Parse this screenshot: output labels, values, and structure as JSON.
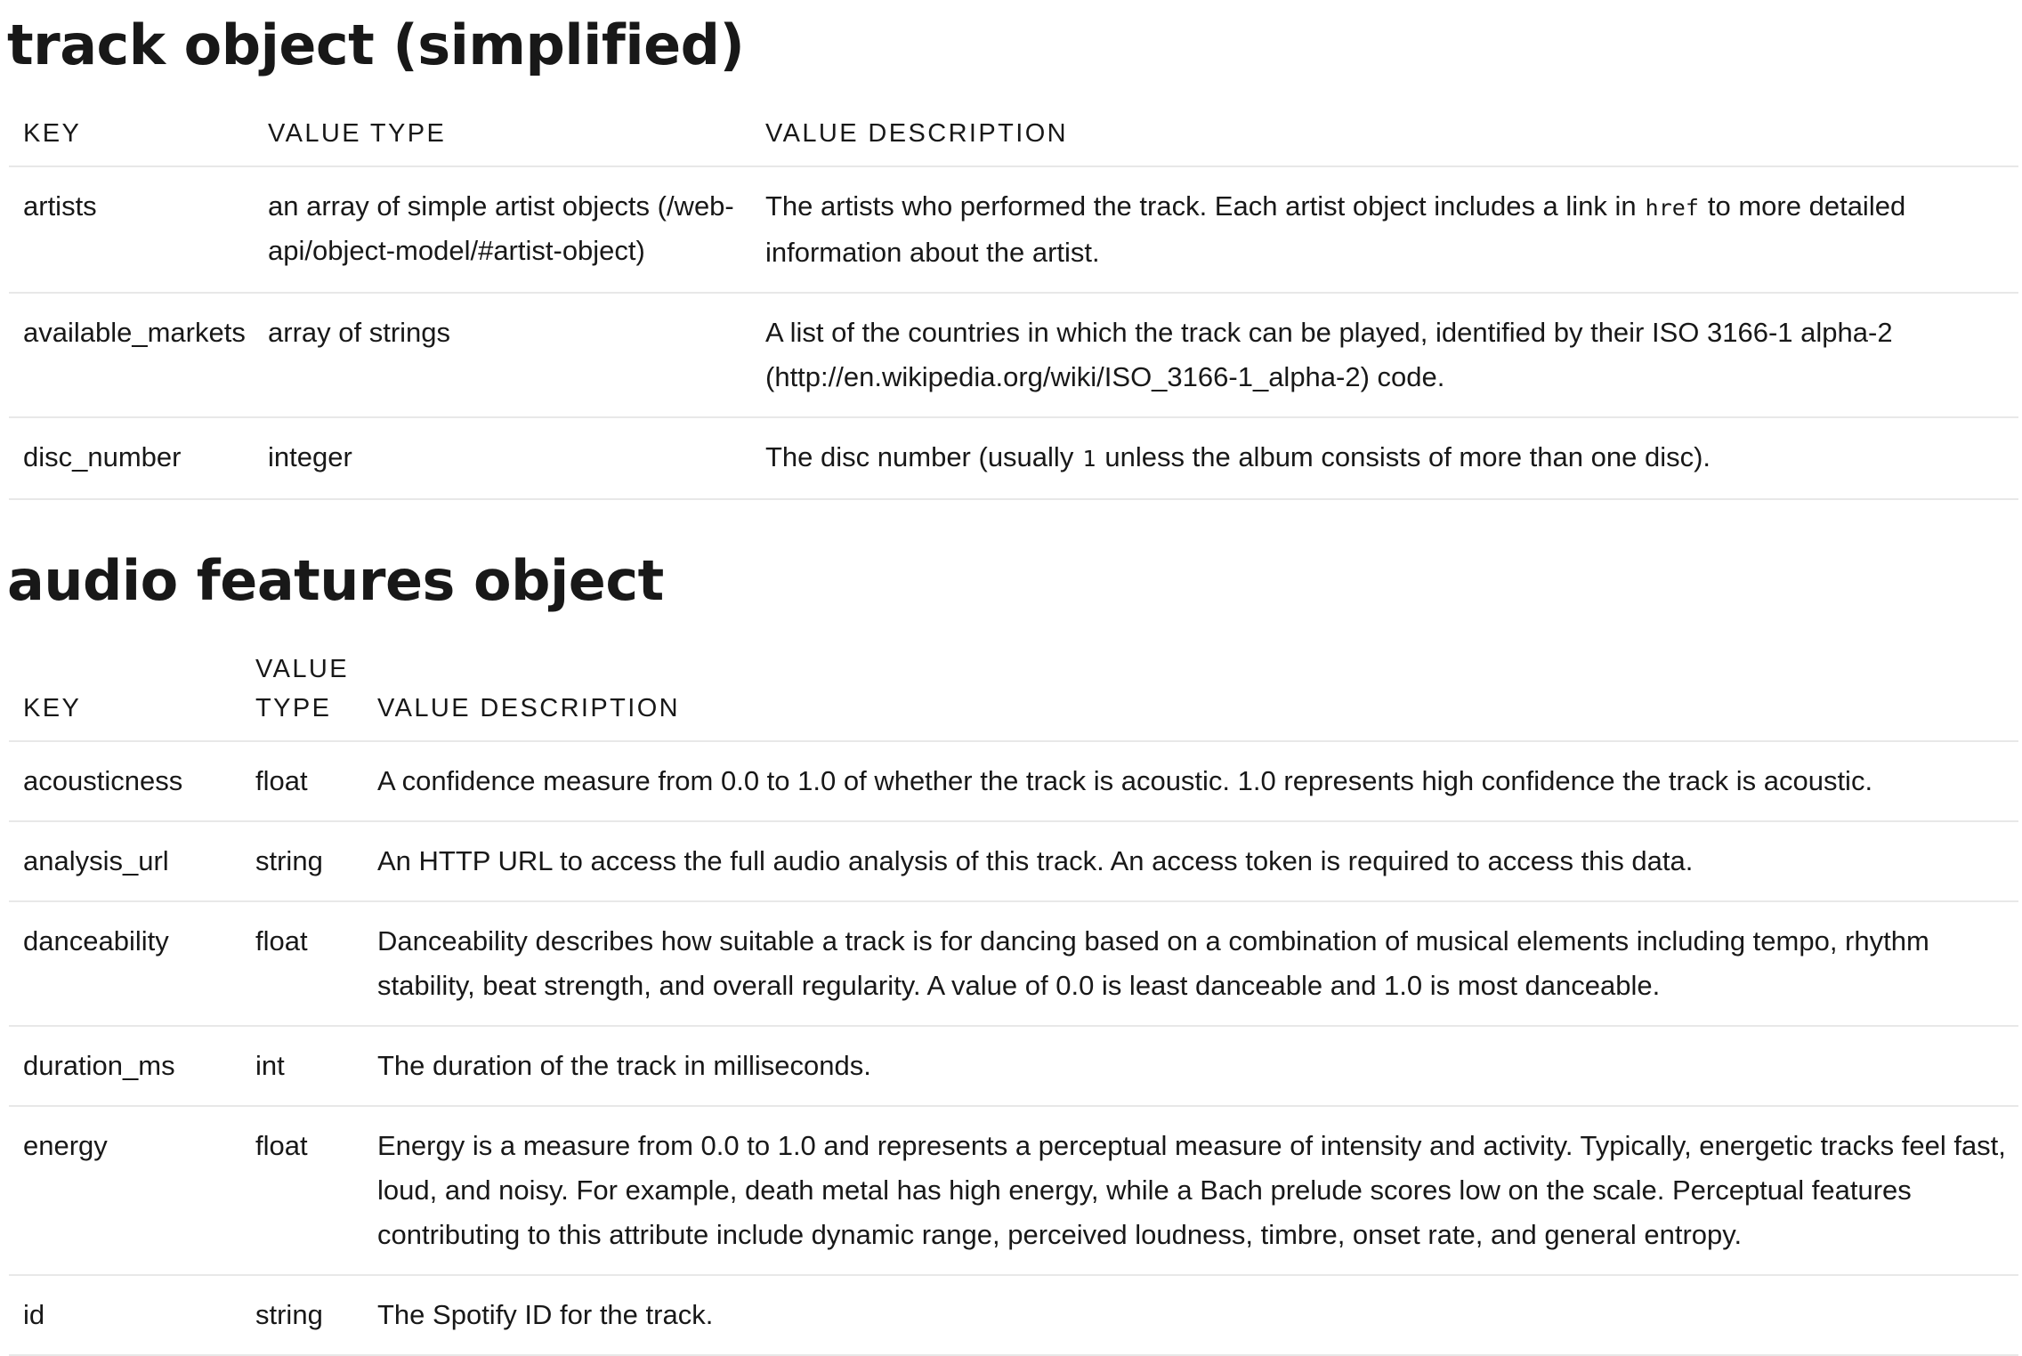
{
  "track_section": {
    "title": "track object (simplified)",
    "headers": {
      "key": "KEY",
      "value_type": "VALUE TYPE",
      "value_description": "VALUE DESCRIPTION"
    },
    "rows": [
      {
        "key": "artists",
        "type": "an array of simple artist objects (/web-api/object-model/#artist-object)",
        "desc_before": "The artists who performed the track. Each artist object includes a link in",
        "desc_code": "href",
        "desc_after": "to more detailed information about the artist."
      },
      {
        "key": "available_markets",
        "type": "array of strings",
        "desc": "A list of the countries in which the track can be played, identified by their ISO 3166-1 alpha-2 (http://en.wikipedia.org/wiki/ISO_3166-1_alpha-2) code."
      },
      {
        "key": "disc_number",
        "type": "integer",
        "desc_before": "The disc number (usually",
        "desc_code": "1",
        "desc_after": "unless the album consists of more than one disc)."
      }
    ]
  },
  "audio_section": {
    "title": "audio features object",
    "headers": {
      "key": "KEY",
      "value_type_line1": "VALUE",
      "value_type_line2": "TYPE",
      "value_description": "VALUE DESCRIPTION"
    },
    "rows": [
      {
        "key": "acousticness",
        "type": "float",
        "desc": "A confidence measure from 0.0 to 1.0 of whether the track is acoustic. 1.0 represents high confidence the track is acoustic."
      },
      {
        "key": "analysis_url",
        "type": "string",
        "desc": "An HTTP URL to access the full audio analysis of this track. An access token is required to access this data."
      },
      {
        "key": "danceability",
        "type": "float",
        "desc": "Danceability describes how suitable a track is for dancing based on a combination of musical elements including tempo, rhythm stability, beat strength, and overall regularity. A value of 0.0 is least danceable and 1.0 is most danceable."
      },
      {
        "key": "duration_ms",
        "type": "int",
        "desc": "The duration of the track in milliseconds."
      },
      {
        "key": "energy",
        "type": "float",
        "desc": "Energy is a measure from 0.0 to 1.0 and represents a perceptual measure of intensity and activity. Typically, energetic tracks feel fast, loud, and noisy. For example, death metal has high energy, while a Bach prelude scores low on the scale. Perceptual features contributing to this attribute include dynamic range, perceived loudness, timbre, onset rate, and general entropy."
      },
      {
        "key": "id",
        "type": "string",
        "desc": "The Spotify ID for the track."
      }
    ]
  }
}
